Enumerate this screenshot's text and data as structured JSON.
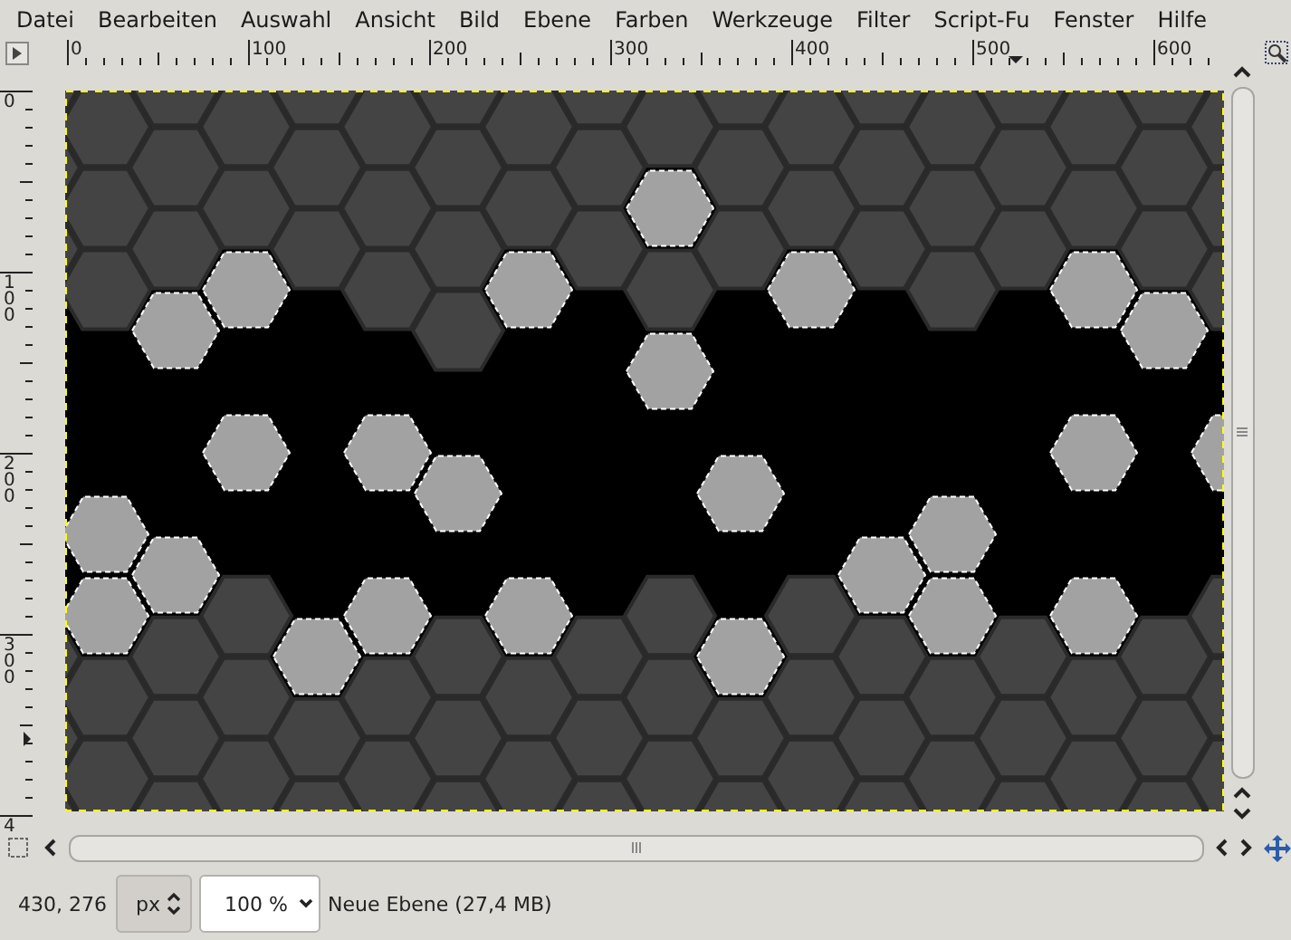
{
  "menu": [
    "Datei",
    "Bearbeiten",
    "Auswahl",
    "Ansicht",
    "Bild",
    "Ebene",
    "Farben",
    "Werkzeuge",
    "Filter",
    "Script-Fu",
    "Fenster",
    "Hilfe"
  ],
  "horizontal_ruler": [
    "0",
    "100",
    "200",
    "300",
    "400",
    "500",
    "600"
  ],
  "vertical_ruler": [
    "0",
    "100",
    "200",
    "300",
    "4"
  ],
  "status_bar": {
    "coordinates": "430, 276",
    "unit": "px",
    "zoom": "100 %",
    "layer_info": "Neue Ebene (27,4 MB)"
  }
}
